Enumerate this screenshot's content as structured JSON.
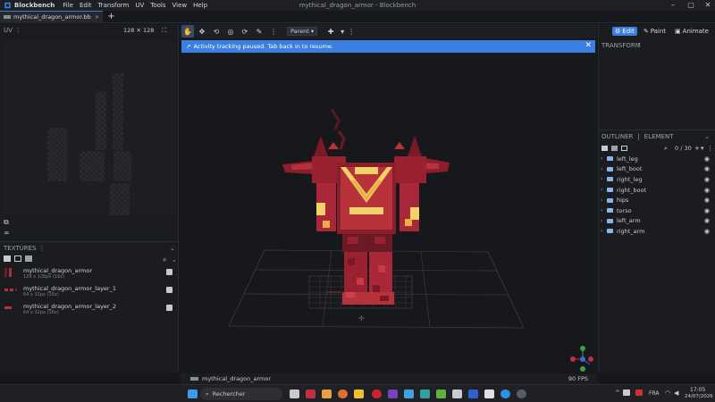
{
  "titlebar": {
    "app_name": "Blockbench",
    "menu": [
      "File",
      "Edit",
      "Transform",
      "UV",
      "Tools",
      "View",
      "Help"
    ],
    "window_title": "mythical_dragon_armor - Blockbench"
  },
  "tabs": {
    "active_file": "mythical_dragon_armor.bb",
    "close_glyph": "×",
    "add_glyph": "+"
  },
  "uv_panel": {
    "title": "UV",
    "size_label": "128 ✕ 128"
  },
  "toolbar": {
    "transform_space": "Parent"
  },
  "notice": {
    "text": "Activity tracking paused. Tab back in to resume."
  },
  "modes": {
    "edit": "Edit",
    "paint": "Paint",
    "animate": "Animate"
  },
  "transform_panel": {
    "title": "TRANSFORM"
  },
  "outliner": {
    "tab_outliner": "OUTLINER",
    "tab_element": "ELEMENT",
    "counter": "0 / 30",
    "items": [
      "left_leg",
      "left_boot",
      "right_leg",
      "right_boot",
      "hips",
      "torso",
      "left_arm",
      "right_arm"
    ]
  },
  "textures": {
    "title": "TEXTURES",
    "items": [
      {
        "name": "mythical_dragon_armor",
        "meta": "128 x 128px (16x)"
      },
      {
        "name": "mythical_dragon_armor_layer_1",
        "meta": "64 x 32px (16x)"
      },
      {
        "name": "mythical_dragon_armor_layer_2",
        "meta": "64 x 32px (16x)"
      }
    ]
  },
  "status": {
    "model_name": "mythical_dragon_armor",
    "fps": "90 FPS"
  },
  "taskbar": {
    "search_placeholder": "Rechercher",
    "lang": "FRA",
    "time": "17:05",
    "date": "24/07/2026"
  },
  "colors": {
    "accent": "#3b7fe0",
    "armor_dark": "#7a1a26",
    "armor_red": "#b8323a",
    "armor_gold": "#f2d06a"
  }
}
